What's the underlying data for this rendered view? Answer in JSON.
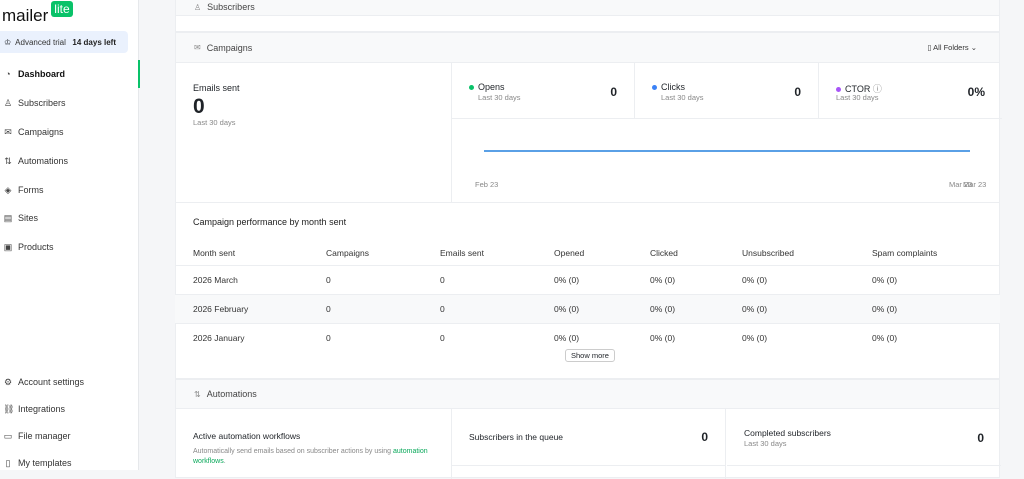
{
  "brand": {
    "name": "mailer",
    "badge": "lite"
  },
  "trial": {
    "label": "Advanced trial",
    "days": "14 days left"
  },
  "nav": [
    {
      "label": "Dashboard",
      "icon": "◔"
    },
    {
      "label": "Subscribers",
      "icon": "♙"
    },
    {
      "label": "Campaigns",
      "icon": "✉"
    },
    {
      "label": "Automations",
      "icon": "⇅"
    },
    {
      "label": "Forms",
      "icon": "◈"
    },
    {
      "label": "Sites",
      "icon": "▤"
    },
    {
      "label": "Products",
      "icon": "▣"
    }
  ],
  "nav_bottom": [
    {
      "label": "Account settings",
      "icon": "⚙"
    },
    {
      "label": "Integrations",
      "icon": "⛓"
    },
    {
      "label": "File manager",
      "icon": "▭"
    },
    {
      "label": "My templates",
      "icon": "▯"
    }
  ],
  "subscribers_header": "Subscribers",
  "campaigns": {
    "title": "Campaigns",
    "folders": "All Folders",
    "emails_sent_label": "Emails sent",
    "emails_sent": "0",
    "period": "Last 30 days",
    "stats": [
      {
        "label": "Opens",
        "value": "0",
        "period": "Last 30 days",
        "color": "#09c269"
      },
      {
        "label": "Clicks",
        "value": "0",
        "period": "Last 30 days",
        "color": "#3b82f6"
      },
      {
        "label": "CTOR",
        "value": "0%",
        "period": "Last 30 days",
        "color": "#a855f7"
      }
    ],
    "chart": {
      "x_start": "Feb 23",
      "x_end": "Mar 23",
      "x_end2": "Mar 23"
    }
  },
  "performance": {
    "title": "Campaign performance by month sent",
    "columns": [
      "Month sent",
      "Campaigns",
      "Emails sent",
      "Opened",
      "Clicked",
      "Unsubscribed",
      "Spam complaints"
    ],
    "rows": [
      [
        "2026 March",
        "0",
        "0",
        "0% (0)",
        "0% (0)",
        "0% (0)",
        "0% (0)"
      ],
      [
        "2026 February",
        "0",
        "0",
        "0% (0)",
        "0% (0)",
        "0% (0)",
        "0% (0)"
      ],
      [
        "2026 January",
        "0",
        "0",
        "0% (0)",
        "0% (0)",
        "0% (0)",
        "0% (0)"
      ]
    ],
    "show_more": "Show more"
  },
  "automations": {
    "title": "Automations",
    "active_title": "Active automation workflows",
    "desc": "Automatically send emails based on subscriber actions by using ",
    "link": "automation workflows",
    "desc_end": ".",
    "queue_label": "Subscribers in the queue",
    "queue_value": "0",
    "completed_label": "Completed subscribers",
    "completed_period": "Last 30 days",
    "completed_value": "0"
  }
}
